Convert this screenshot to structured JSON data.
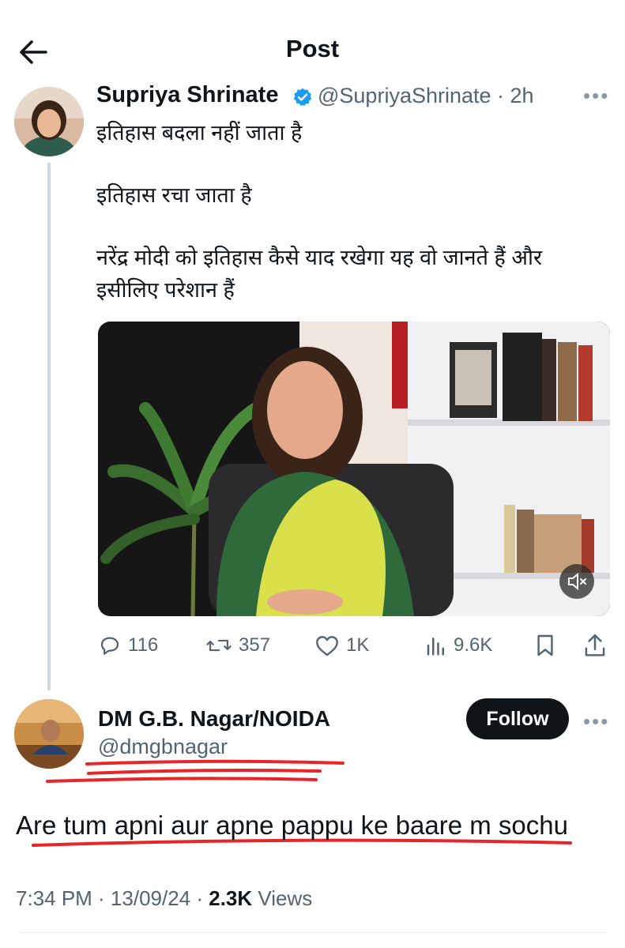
{
  "header": {
    "title": "Post",
    "back_icon": "arrow-left-icon"
  },
  "tweet": {
    "author_name": "Supriya Shrinate",
    "verified_icon": "verified-badge-icon",
    "handle_time": "@SupriyaShrinate · 2h",
    "lines": [
      "इतिहास बदला नहीं जाता है",
      "इतिहास रचा जाता है",
      "नरेंद्र मोदी को इतिहास कैसे याद रखेगा यह वो जानते हैं और इसीलिए परेशान हैं"
    ],
    "stats": {
      "replies": "116",
      "reposts": "357",
      "likes": "1K",
      "views": "9.6K"
    }
  },
  "reply": {
    "author_name": "DM G.B. Nagar/NOIDA",
    "handle": "@dmgbnagar",
    "follow_label": "Follow",
    "text": "Are tum apni aur apne pappu ke baare m sochu",
    "time_date": "7:34 PM · 13/09/24 · ",
    "views_count": "2.3K",
    "views_label": " Views"
  },
  "colors": {
    "text": "#0f1419",
    "muted": "#536471",
    "verified": "#1d9bf0",
    "annotation": "#e8262a"
  }
}
